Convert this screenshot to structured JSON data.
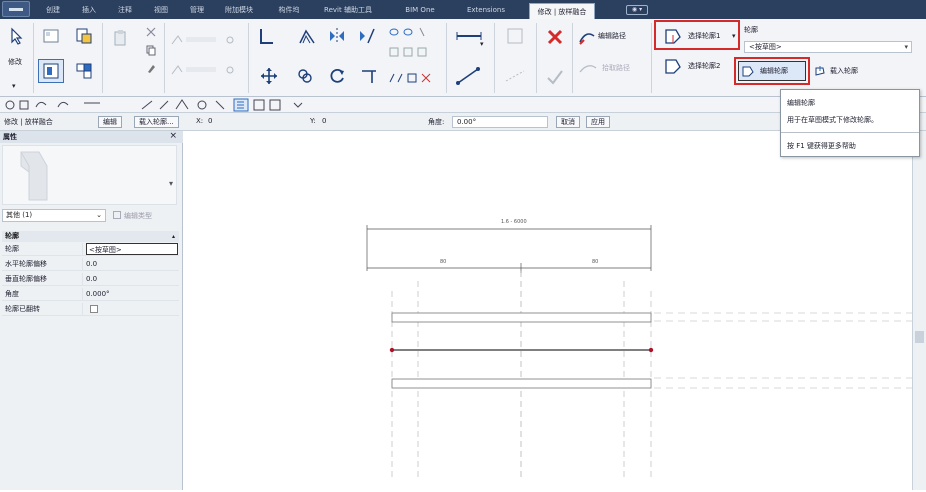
{
  "tabs": [
    {
      "label": "创建",
      "active": false
    },
    {
      "label": "插入",
      "active": false
    },
    {
      "label": "注释",
      "active": false
    },
    {
      "label": "视图",
      "active": false
    },
    {
      "label": "管理",
      "active": false
    },
    {
      "label": "附加模块",
      "active": false
    },
    {
      "label": "构件坞",
      "active": false
    },
    {
      "label": "Revit 辅助工具",
      "active": false
    },
    {
      "label": "BIM One",
      "active": false
    },
    {
      "label": "Extensions",
      "active": false
    },
    {
      "label": "修改 | 放样融合",
      "active": true
    }
  ],
  "ribbon": {
    "modify_label": "修改",
    "edit_trajectory_label": "编辑路径",
    "select_profile1_label": "选择轮廓1",
    "select_profile2_label": "选择轮廓2",
    "edit_profile_label": "编辑轮廓",
    "load_profile_label": "载入轮廓",
    "profile_label": "轮廓",
    "profile_combo_value": "<按草图>",
    "faded_label_1": "绘制路径",
    "faded_label_2": "拾取路径",
    "dropdown_glyph": "▾"
  },
  "options_bar": {
    "context": "修改 | 放样融合",
    "edit_button": "编辑",
    "load_profile_button": "载入轮廓...",
    "x_label": "X:",
    "x_value": "0",
    "y_label": "Y:",
    "y_value": "0",
    "angle_label": "角度:",
    "angle_value": "0.00°",
    "cancel_button": "取消",
    "apply_button": "应用"
  },
  "properties": {
    "title": "属性",
    "close": "×",
    "type_selector": "其他 (1)",
    "edit_type": "编辑类型",
    "category": "轮廓",
    "rows": [
      {
        "key": "轮廓",
        "value": "<按草图>",
        "boxed": true
      },
      {
        "key": "水平轮廓偏移",
        "value": "0.0"
      },
      {
        "key": "垂直轮廓偏移",
        "value": "0.0"
      },
      {
        "key": "角度",
        "value": "0.000°"
      },
      {
        "key": "轮廓已翻转",
        "value": "",
        "checkbox": true
      }
    ]
  },
  "tooltip": {
    "title": "编辑轮廓",
    "description": "用于在草图模式下修改轮廓。",
    "help": "按 F1 键获得更多帮助"
  },
  "canvas": {
    "dim_total": "1.6 - 6000",
    "dim_left": "80",
    "dim_right": "80"
  },
  "colors": {
    "tab_bar": "#2b3f5e",
    "highlight_red": "#d42a2a",
    "endpoint_red": "#b0102a"
  }
}
